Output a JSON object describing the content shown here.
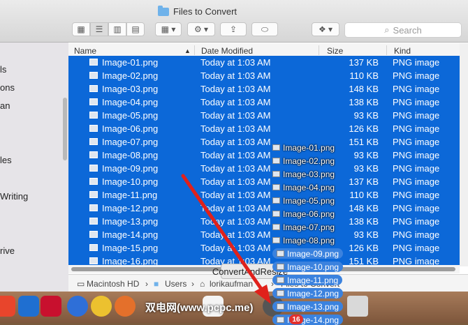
{
  "window": {
    "title": "Files to Convert"
  },
  "toolbar": {
    "search_placeholder": "Search"
  },
  "sidebar": {
    "items": [
      "ls",
      "ons",
      "an",
      "les",
      "Writing",
      "rive"
    ]
  },
  "columns": {
    "name": "Name",
    "date": "Date Modified",
    "size": "Size",
    "kind": "Kind"
  },
  "files": [
    {
      "name": "Image-01.png",
      "date": "Today at 1:03 AM",
      "size": "137 KB",
      "kind": "PNG image"
    },
    {
      "name": "Image-02.png",
      "date": "Today at 1:03 AM",
      "size": "110 KB",
      "kind": "PNG image"
    },
    {
      "name": "Image-03.png",
      "date": "Today at 1:03 AM",
      "size": "148 KB",
      "kind": "PNG image"
    },
    {
      "name": "Image-04.png",
      "date": "Today at 1:03 AM",
      "size": "138 KB",
      "kind": "PNG image"
    },
    {
      "name": "Image-05.png",
      "date": "Today at 1:03 AM",
      "size": "93 KB",
      "kind": "PNG image"
    },
    {
      "name": "Image-06.png",
      "date": "Today at 1:03 AM",
      "size": "126 KB",
      "kind": "PNG image"
    },
    {
      "name": "Image-07.png",
      "date": "Today at 1:03 AM",
      "size": "151 KB",
      "kind": "PNG image"
    },
    {
      "name": "Image-08.png",
      "date": "Today at 1:03 AM",
      "size": "93 KB",
      "kind": "PNG image"
    },
    {
      "name": "Image-09.png",
      "date": "Today at 1:03 AM",
      "size": "93 KB",
      "kind": "PNG image"
    },
    {
      "name": "Image-10.png",
      "date": "Today at 1:03 AM",
      "size": "137 KB",
      "kind": "PNG image"
    },
    {
      "name": "Image-11.png",
      "date": "Today at 1:03 AM",
      "size": "110 KB",
      "kind": "PNG image"
    },
    {
      "name": "Image-12.png",
      "date": "Today at 1:03 AM",
      "size": "148 KB",
      "kind": "PNG image"
    },
    {
      "name": "Image-13.png",
      "date": "Today at 1:03 AM",
      "size": "138 KB",
      "kind": "PNG image"
    },
    {
      "name": "Image-14.png",
      "date": "Today at 1:03 AM",
      "size": "93 KB",
      "kind": "PNG image"
    },
    {
      "name": "Image-15.png",
      "date": "Today at 1:03 AM",
      "size": "126 KB",
      "kind": "PNG image"
    },
    {
      "name": "Image-16.png",
      "date": "Today at 1:03 AM",
      "size": "151 KB",
      "kind": "PNG image"
    }
  ],
  "drag_items": [
    "Image-01.png",
    "Image-02.png",
    "Image-03.png",
    "Image-04.png",
    "Image-05.png",
    "Image-06.png",
    "Image-07.png",
    "Image-08.png",
    "Image-09.png",
    "Image-10.png",
    "Image-11.png",
    "Image-12.png",
    "Image-13.png",
    "Image-14.png"
  ],
  "path_bar": {
    "items": [
      "Macintosh HD",
      "Users",
      "lorikaufman",
      "Files to Convert"
    ]
  },
  "tooltip": "ConvertAndResize",
  "drag_badge": "16",
  "watermark": "双电网(www.pcpc.me)",
  "colors": {
    "selection": "#0c68d8",
    "accent_arrow": "#e0211b"
  }
}
